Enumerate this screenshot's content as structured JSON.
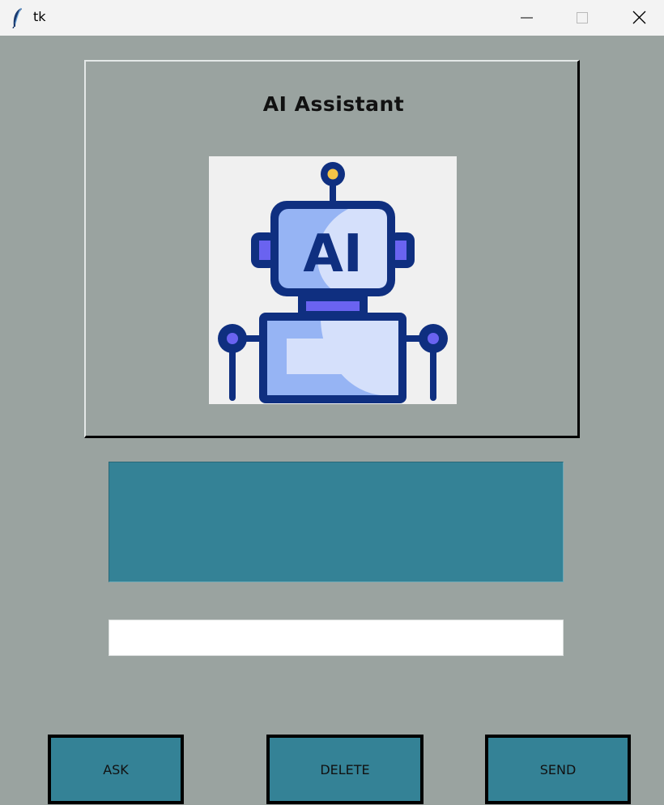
{
  "window": {
    "title": "tk",
    "app_icon": "tk-feather-icon",
    "controls": [
      "minimize-icon",
      "maximize-icon",
      "close-icon"
    ]
  },
  "header": {
    "title": "AI Assistant"
  },
  "image": {
    "icon": "robot-ai-icon",
    "text": "AI"
  },
  "output": {
    "text": ""
  },
  "entry": {
    "value": "",
    "placeholder": ""
  },
  "buttons": {
    "ask": "ASK",
    "delete": "DELETE",
    "send": "SEND"
  },
  "colors": {
    "background": "#9aa3a0",
    "teal": "#348296",
    "robot_navy": "#0f2f80",
    "robot_light": "#96b4f4",
    "robot_purple": "#6a63f0",
    "antenna_yellow": "#f6c447"
  }
}
